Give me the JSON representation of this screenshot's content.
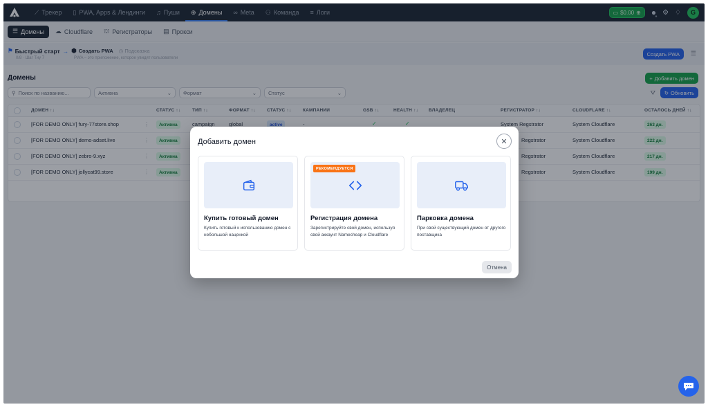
{
  "nav": {
    "items": [
      {
        "icon": "chart-line-icon",
        "glyph": "⟋",
        "label": "Трекер",
        "active": false
      },
      {
        "icon": "phone-icon",
        "glyph": "▯",
        "label": "PWA, Apps & Лендинги",
        "active": false
      },
      {
        "icon": "bell-icon",
        "glyph": "♫",
        "label": "Пуши",
        "active": false
      },
      {
        "icon": "globe-icon",
        "glyph": "⊕",
        "label": "Домены",
        "active": true
      },
      {
        "icon": "meta-icon",
        "glyph": "∞",
        "label": "Meta",
        "active": false
      },
      {
        "icon": "team-icon",
        "glyph": "⚇",
        "label": "Команда",
        "active": false
      },
      {
        "icon": "logs-icon",
        "glyph": "≡",
        "label": "Логи",
        "active": false
      }
    ],
    "balance": "$0.00"
  },
  "subnav": {
    "items": [
      {
        "icon": "list-icon",
        "glyph": "☰",
        "label": "Домены",
        "active": true
      },
      {
        "icon": "cloud-icon",
        "glyph": "☁",
        "label": "Cloudflare",
        "active": false
      },
      {
        "icon": "registrar-icon",
        "glyph": "⛫",
        "label": "Регистраторы",
        "active": false
      },
      {
        "icon": "proxy-icon",
        "glyph": "▤",
        "label": "Прокси",
        "active": false
      }
    ]
  },
  "quickstart": {
    "title": "Быстрый старт",
    "step": "Создать PWA",
    "hint": "Подсказка",
    "sub1": "0/8 · Шаг Тиу 7",
    "sub2": "PWA – это приложение, которое увидят пользователи",
    "create_button": "Создать PWA"
  },
  "domains": {
    "title": "Домены",
    "add_button": "Добавить домен",
    "refresh_button": "Обновить",
    "search_placeholder": "Поиск по названию...",
    "filter_status_value": "Активна",
    "filter_format": "Формат",
    "filter_status": "Статус"
  },
  "table": {
    "headers": {
      "domain": "ДОМЕН ↑↓",
      "status": "СТАТУС ↑↓",
      "type": "ТИП ↑↓",
      "format": "ФОРМАТ ↑↓",
      "status2": "СТАТУС ↑↓",
      "campaigns": "КАМПАНИИ",
      "gsb": "GSB ↑↓",
      "health": "HEALTH ↑↓",
      "owner": "ВЛАДЕЛЕЦ",
      "registrar": "РЕГИСТРАТОР ↑↓",
      "cloudflare": "CLOUDFLARE ↑↓",
      "days": "ОСТАЛОСЬ ДНЕЙ ↑↓"
    },
    "rows": [
      {
        "domain": "[FOR DEMO ONLY] fury-77store.shop",
        "status": "Активна",
        "type": "campaign",
        "format": "global",
        "state": "active",
        "campaigns": "-",
        "registrar": "System Regstrator",
        "cloudflare": "System Cloudflare",
        "days": "263 дн."
      },
      {
        "domain": "[FOR DEMO ONLY] demo-adset.live",
        "status": "Активна",
        "registrar": "Regstrator",
        "cloudflare": "System Cloudflare",
        "days": "222 дн."
      },
      {
        "domain": "[FOR DEMO ONLY] zebro-9.xyz",
        "status": "Активна",
        "registrar": "Regstrator",
        "cloudflare": "System Cloudflare",
        "days": "217 дн."
      },
      {
        "domain": "[FOR DEMO ONLY] jollycat99.store",
        "status": "Активна",
        "registrar": "Regstrator",
        "cloudflare": "System Cloudflare",
        "days": "199 дн."
      }
    ]
  },
  "modal": {
    "title": "Добавить домен",
    "cancel": "Отмена",
    "cards": [
      {
        "icon": "wallet-icon",
        "title": "Купить готовый домен",
        "desc": "Купить готовый к использованию домен с небольшой наценкой"
      },
      {
        "icon": "code-icon",
        "badge": "РЕКОМЕНДУЕТСЯ",
        "title": "Регистрация домена",
        "desc": "Зарегистрируйте свой домен, используя свой аккаунт Namecheap и Cloudflare"
      },
      {
        "icon": "truck-icon",
        "title": "Парковка домена",
        "desc": "При свой существующий домен от другого поставщика"
      }
    ]
  },
  "colors": {
    "topbar": "#1d2733",
    "accent": "#2563eb",
    "success": "#16a34a",
    "badge_orange": "#f97316"
  }
}
